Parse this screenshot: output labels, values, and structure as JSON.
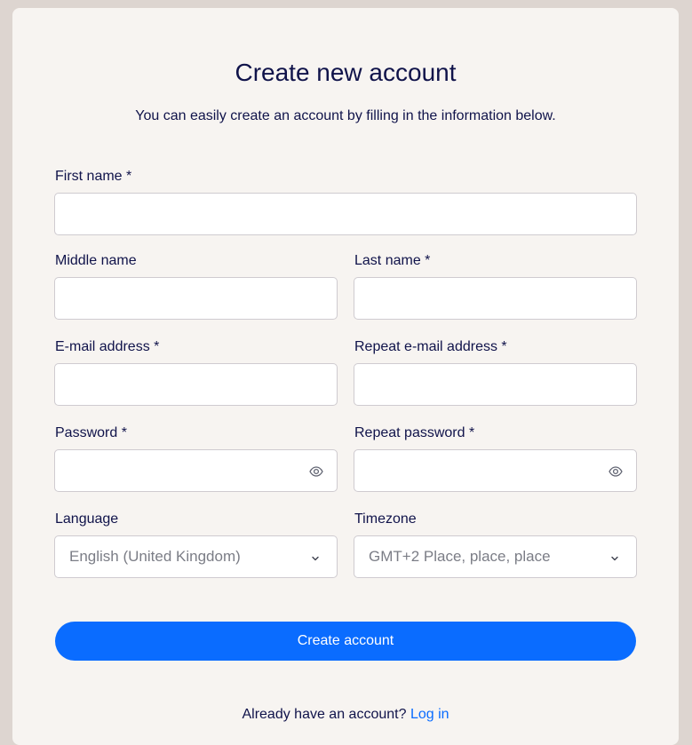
{
  "header": {
    "title": "Create new account",
    "subtitle": "You can easily create an account by filling in the information below."
  },
  "form": {
    "first_name": {
      "label": "First name *",
      "value": "",
      "placeholder": ""
    },
    "middle_name": {
      "label": "Middle name",
      "value": "",
      "placeholder": ""
    },
    "last_name": {
      "label": "Last name *",
      "value": "",
      "placeholder": ""
    },
    "email": {
      "label": "E-mail address *",
      "value": "",
      "placeholder": ""
    },
    "repeat_email": {
      "label": "Repeat e-mail address *",
      "value": "",
      "placeholder": ""
    },
    "password": {
      "label": "Password *",
      "value": "",
      "placeholder": "",
      "icon": "eye-icon"
    },
    "repeat_password": {
      "label": "Repeat password *",
      "value": "",
      "placeholder": "",
      "icon": "eye-icon"
    },
    "language": {
      "label": "Language",
      "selected": "English (United Kingdom)",
      "icon": "chevron-down-icon"
    },
    "timezone": {
      "label": "Timezone",
      "selected": "GMT+2 Place, place, place",
      "icon": "chevron-down-icon"
    }
  },
  "actions": {
    "submit_label": "Create account"
  },
  "footer": {
    "prompt": "Already have an account?",
    "login_link": "Log in"
  },
  "colors": {
    "page_background": "#ddd5d0",
    "card_background": "#f7f4f1",
    "text": "#10134a",
    "accent": "#0a6cff",
    "input_border": "#cfcbd0",
    "muted_text": "#7b7d86"
  }
}
